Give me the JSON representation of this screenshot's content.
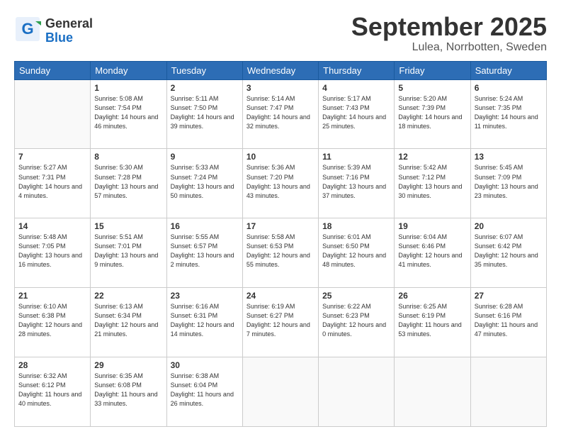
{
  "logo": {
    "general": "General",
    "blue": "Blue"
  },
  "header": {
    "month": "September 2025",
    "location": "Lulea, Norrbotten, Sweden"
  },
  "weekdays": [
    "Sunday",
    "Monday",
    "Tuesday",
    "Wednesday",
    "Thursday",
    "Friday",
    "Saturday"
  ],
  "weeks": [
    [
      {
        "day": "",
        "sunrise": "",
        "sunset": "",
        "daylight": ""
      },
      {
        "day": "1",
        "sunrise": "Sunrise: 5:08 AM",
        "sunset": "Sunset: 7:54 PM",
        "daylight": "Daylight: 14 hours and 46 minutes."
      },
      {
        "day": "2",
        "sunrise": "Sunrise: 5:11 AM",
        "sunset": "Sunset: 7:50 PM",
        "daylight": "Daylight: 14 hours and 39 minutes."
      },
      {
        "day": "3",
        "sunrise": "Sunrise: 5:14 AM",
        "sunset": "Sunset: 7:47 PM",
        "daylight": "Daylight: 14 hours and 32 minutes."
      },
      {
        "day": "4",
        "sunrise": "Sunrise: 5:17 AM",
        "sunset": "Sunset: 7:43 PM",
        "daylight": "Daylight: 14 hours and 25 minutes."
      },
      {
        "day": "5",
        "sunrise": "Sunrise: 5:20 AM",
        "sunset": "Sunset: 7:39 PM",
        "daylight": "Daylight: 14 hours and 18 minutes."
      },
      {
        "day": "6",
        "sunrise": "Sunrise: 5:24 AM",
        "sunset": "Sunset: 7:35 PM",
        "daylight": "Daylight: 14 hours and 11 minutes."
      }
    ],
    [
      {
        "day": "7",
        "sunrise": "Sunrise: 5:27 AM",
        "sunset": "Sunset: 7:31 PM",
        "daylight": "Daylight: 14 hours and 4 minutes."
      },
      {
        "day": "8",
        "sunrise": "Sunrise: 5:30 AM",
        "sunset": "Sunset: 7:28 PM",
        "daylight": "Daylight: 13 hours and 57 minutes."
      },
      {
        "day": "9",
        "sunrise": "Sunrise: 5:33 AM",
        "sunset": "Sunset: 7:24 PM",
        "daylight": "Daylight: 13 hours and 50 minutes."
      },
      {
        "day": "10",
        "sunrise": "Sunrise: 5:36 AM",
        "sunset": "Sunset: 7:20 PM",
        "daylight": "Daylight: 13 hours and 43 minutes."
      },
      {
        "day": "11",
        "sunrise": "Sunrise: 5:39 AM",
        "sunset": "Sunset: 7:16 PM",
        "daylight": "Daylight: 13 hours and 37 minutes."
      },
      {
        "day": "12",
        "sunrise": "Sunrise: 5:42 AM",
        "sunset": "Sunset: 7:12 PM",
        "daylight": "Daylight: 13 hours and 30 minutes."
      },
      {
        "day": "13",
        "sunrise": "Sunrise: 5:45 AM",
        "sunset": "Sunset: 7:09 PM",
        "daylight": "Daylight: 13 hours and 23 minutes."
      }
    ],
    [
      {
        "day": "14",
        "sunrise": "Sunrise: 5:48 AM",
        "sunset": "Sunset: 7:05 PM",
        "daylight": "Daylight: 13 hours and 16 minutes."
      },
      {
        "day": "15",
        "sunrise": "Sunrise: 5:51 AM",
        "sunset": "Sunset: 7:01 PM",
        "daylight": "Daylight: 13 hours and 9 minutes."
      },
      {
        "day": "16",
        "sunrise": "Sunrise: 5:55 AM",
        "sunset": "Sunset: 6:57 PM",
        "daylight": "Daylight: 13 hours and 2 minutes."
      },
      {
        "day": "17",
        "sunrise": "Sunrise: 5:58 AM",
        "sunset": "Sunset: 6:53 PM",
        "daylight": "Daylight: 12 hours and 55 minutes."
      },
      {
        "day": "18",
        "sunrise": "Sunrise: 6:01 AM",
        "sunset": "Sunset: 6:50 PM",
        "daylight": "Daylight: 12 hours and 48 minutes."
      },
      {
        "day": "19",
        "sunrise": "Sunrise: 6:04 AM",
        "sunset": "Sunset: 6:46 PM",
        "daylight": "Daylight: 12 hours and 41 minutes."
      },
      {
        "day": "20",
        "sunrise": "Sunrise: 6:07 AM",
        "sunset": "Sunset: 6:42 PM",
        "daylight": "Daylight: 12 hours and 35 minutes."
      }
    ],
    [
      {
        "day": "21",
        "sunrise": "Sunrise: 6:10 AM",
        "sunset": "Sunset: 6:38 PM",
        "daylight": "Daylight: 12 hours and 28 minutes."
      },
      {
        "day": "22",
        "sunrise": "Sunrise: 6:13 AM",
        "sunset": "Sunset: 6:34 PM",
        "daylight": "Daylight: 12 hours and 21 minutes."
      },
      {
        "day": "23",
        "sunrise": "Sunrise: 6:16 AM",
        "sunset": "Sunset: 6:31 PM",
        "daylight": "Daylight: 12 hours and 14 minutes."
      },
      {
        "day": "24",
        "sunrise": "Sunrise: 6:19 AM",
        "sunset": "Sunset: 6:27 PM",
        "daylight": "Daylight: 12 hours and 7 minutes."
      },
      {
        "day": "25",
        "sunrise": "Sunrise: 6:22 AM",
        "sunset": "Sunset: 6:23 PM",
        "daylight": "Daylight: 12 hours and 0 minutes."
      },
      {
        "day": "26",
        "sunrise": "Sunrise: 6:25 AM",
        "sunset": "Sunset: 6:19 PM",
        "daylight": "Daylight: 11 hours and 53 minutes."
      },
      {
        "day": "27",
        "sunrise": "Sunrise: 6:28 AM",
        "sunset": "Sunset: 6:16 PM",
        "daylight": "Daylight: 11 hours and 47 minutes."
      }
    ],
    [
      {
        "day": "28",
        "sunrise": "Sunrise: 6:32 AM",
        "sunset": "Sunset: 6:12 PM",
        "daylight": "Daylight: 11 hours and 40 minutes."
      },
      {
        "day": "29",
        "sunrise": "Sunrise: 6:35 AM",
        "sunset": "Sunset: 6:08 PM",
        "daylight": "Daylight: 11 hours and 33 minutes."
      },
      {
        "day": "30",
        "sunrise": "Sunrise: 6:38 AM",
        "sunset": "Sunset: 6:04 PM",
        "daylight": "Daylight: 11 hours and 26 minutes."
      },
      {
        "day": "",
        "sunrise": "",
        "sunset": "",
        "daylight": ""
      },
      {
        "day": "",
        "sunrise": "",
        "sunset": "",
        "daylight": ""
      },
      {
        "day": "",
        "sunrise": "",
        "sunset": "",
        "daylight": ""
      },
      {
        "day": "",
        "sunrise": "",
        "sunset": "",
        "daylight": ""
      }
    ]
  ]
}
